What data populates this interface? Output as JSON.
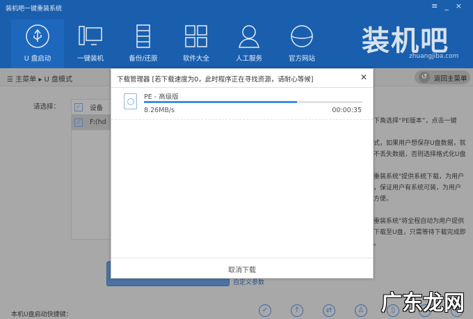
{
  "window": {
    "title": "装机吧一键重装系统",
    "controls": [
      "≡",
      "_",
      "×"
    ]
  },
  "nav": [
    {
      "label": "U 盘启动",
      "icon": "usb-icon",
      "active": true
    },
    {
      "label": "一键装机",
      "icon": "computer-icon"
    },
    {
      "label": "备份/还原",
      "icon": "backup-icon"
    },
    {
      "label": "软件大全",
      "icon": "apps-grid-icon"
    },
    {
      "label": "人工服务",
      "icon": "user-service-icon"
    },
    {
      "label": "官方网站",
      "icon": "globe-icon"
    }
  ],
  "logo": {
    "text": "装机吧",
    "url": "zhuangjiba.com"
  },
  "breadcrumb": {
    "root": "主菜单",
    "current": "U 盘模式"
  },
  "back_button": "返回主菜单",
  "select_label": "请选择：",
  "table": {
    "header": "设备",
    "rows": [
      "F:(hd"
    ]
  },
  "right_text": [
    "下角选择“PE版本”，点击一键",
    "",
    "式，如果用户想保存U盘数据，就",
    "不丢失数据，否则选择格式化U盘",
    "",
    "重装系统\"提供系统下载，为用户",
    "，保证用户有系统可装，为用户",
    "方便。",
    "",
    "重装系统\"将全程自动为用户提供",
    "下载至U盘，只需等待下载完成即",
    "。"
  ],
  "custom_params": "自定义参数",
  "hotkey_label": "本机U盘启动快捷键：",
  "watermark": "广东龙网",
  "dialog": {
    "title": "下载管理器 [若下载速度为0，此时程序正在寻找资源，请耐心等候]",
    "item": {
      "name": "PE - 高级版",
      "speed": "8.26MB/s",
      "time": "00:00:35",
      "progress": 0.7
    },
    "cancel": "取消下载"
  }
}
